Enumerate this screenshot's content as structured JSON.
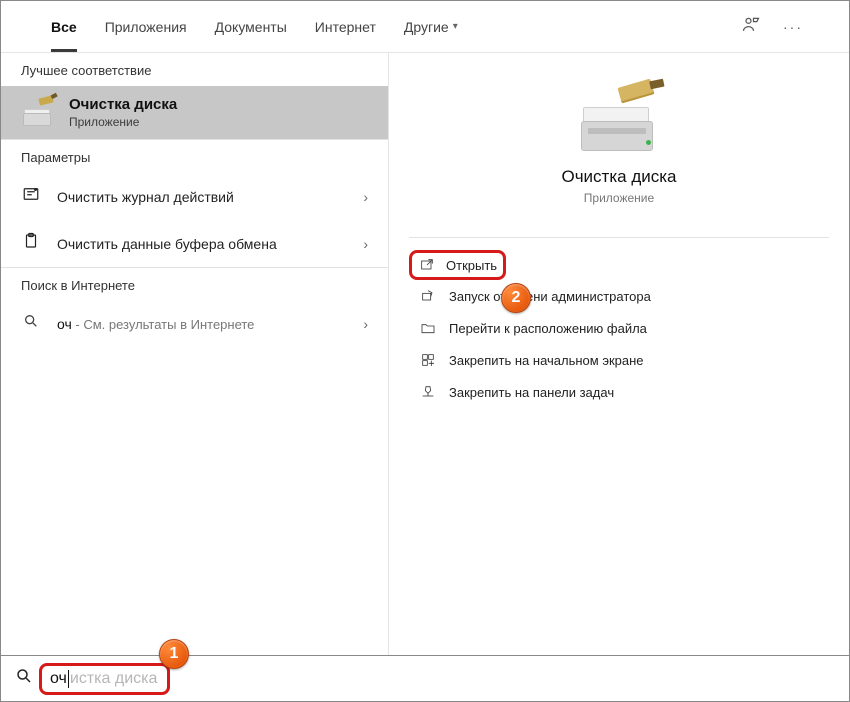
{
  "tabs": {
    "all": "Все",
    "apps": "Приложения",
    "docs": "Документы",
    "web": "Интернет",
    "other": "Другие"
  },
  "sections": {
    "best": "Лучшее соответствие",
    "params": "Параметры",
    "webHeader": "Поиск в Интернете"
  },
  "bestMatch": {
    "title": "Очистка диска",
    "subtitle": "Приложение"
  },
  "settings": {
    "item1": "Очистить журнал действий",
    "item2": "Очистить данные буфера обмена"
  },
  "webResult": {
    "query": "оч",
    "rest": " - См. результаты в Интернете"
  },
  "preview": {
    "title": "Очистка диска",
    "subtitle": "Приложение"
  },
  "actions": {
    "open": "Открыть",
    "runAdmin": "Запуск от имени администратора",
    "openLocation": "Перейти к расположению файла",
    "pinStart": "Закрепить на начальном экране",
    "pinTaskbar": "Закрепить на панели задач"
  },
  "search": {
    "typed": "оч",
    "ghost": "истка диска"
  },
  "badges": {
    "one": "1",
    "two": "2"
  }
}
